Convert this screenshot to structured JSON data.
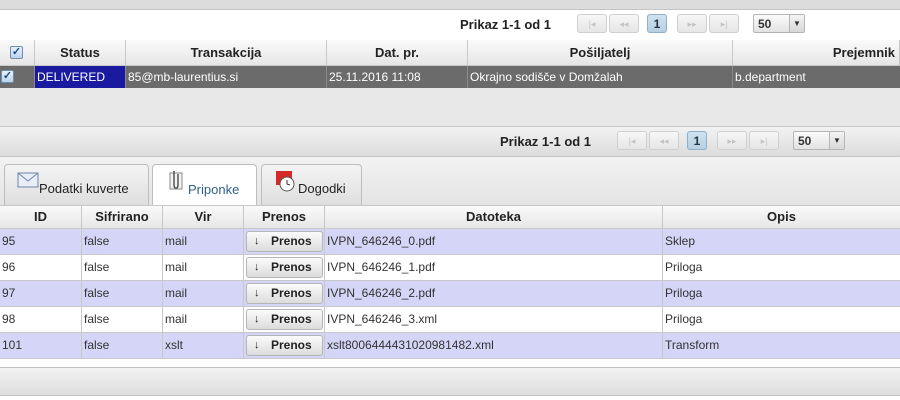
{
  "pager_top": {
    "summary": "Prikaz 1-1 od 1",
    "first": "|◂",
    "prev": "◂◂",
    "page": "1",
    "next": "▸▸",
    "last": "▸|",
    "page_size": "50"
  },
  "envelopes": {
    "columns": [
      "Status",
      "Transakcija",
      "Dat. pr.",
      "Pošiljatelj",
      "Prejemnik"
    ],
    "rows": [
      {
        "status": "DELIVERED",
        "transaction": "85@mb-laurentius.si",
        "date": "25.11.2016 11:08",
        "sender": "Okrajno sodišče v Domžalah",
        "recipient": "b.department"
      }
    ]
  },
  "pager_bottom": {
    "summary": "Prikaz 1-1 od 1",
    "first": "|◂",
    "prev": "◂◂",
    "page": "1",
    "next": "▸▸",
    "last": "▸|",
    "page_size": "50"
  },
  "tabs": [
    {
      "label": "Podatki kuverte",
      "icon": "envelope-icon",
      "active": false
    },
    {
      "label": "Priponke",
      "icon": "paperclip-icon",
      "active": true
    },
    {
      "label": "Dogodki",
      "icon": "calendar-clock-icon",
      "active": false
    }
  ],
  "attachments": {
    "columns": [
      "ID",
      "Sifrirano",
      "Vir",
      "Prenos",
      "Datoteka",
      "Opis"
    ],
    "download_label": "Prenos",
    "rows": [
      {
        "id": "95",
        "encrypted": "false",
        "source": "mail",
        "file": "IVPN_646246_0.pdf",
        "description": "Sklep"
      },
      {
        "id": "96",
        "encrypted": "false",
        "source": "mail",
        "file": "IVPN_646246_1.pdf",
        "description": "Priloga"
      },
      {
        "id": "97",
        "encrypted": "false",
        "source": "mail",
        "file": "IVPN_646246_2.pdf",
        "description": "Priloga"
      },
      {
        "id": "98",
        "encrypted": "false",
        "source": "mail",
        "file": "IVPN_646246_3.xml",
        "description": "Priloga"
      },
      {
        "id": "101",
        "encrypted": "false",
        "source": "xslt",
        "file": "xslt8006444431020981482.xml",
        "description": "Transform"
      }
    ]
  },
  "colors": {
    "selected_row": "#6b6b6b",
    "status_cell": "#1a1aa0",
    "odd_row": "#d5d5f7",
    "active_tab_text": "#2f5f8a"
  }
}
